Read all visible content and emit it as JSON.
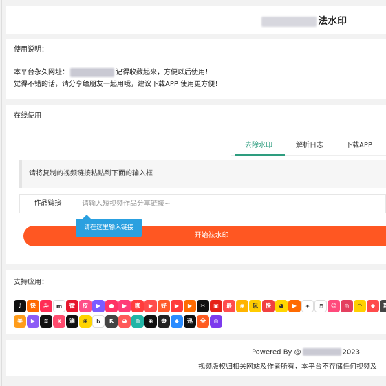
{
  "header": {
    "title_suffix": "法水印"
  },
  "instructions": {
    "heading": "使用说明：",
    "line1_prefix": "本平台永久网址：",
    "line1_suffix": "记得收藏起来，方便以后使用！",
    "line2": "觉得不错的话，请分享给朋友一起用哦，建议下载APP 使用更方便！"
  },
  "online": {
    "heading": "在线使用",
    "tabs": [
      {
        "label": "去除水印",
        "active": true
      },
      {
        "label": "解析日志",
        "active": false
      },
      {
        "label": "下载APP",
        "active": false
      }
    ],
    "notice": "请将复制的视频链接粘贴到下面的输入框",
    "input_label": "作品链接",
    "input_placeholder": "请输入短视频作品分享链接~",
    "input_value": "",
    "tooltip": "请在这里输入链接",
    "start_button": "开始祛水印"
  },
  "apps": {
    "heading": "支持应用：",
    "row1": [
      {
        "name": "douyin-icon",
        "color": "#111111",
        "glyph": "♪"
      },
      {
        "name": "kuaishou-icon",
        "color": "#ff6a00",
        "glyph": "快"
      },
      {
        "name": "doushou-icon",
        "color": "#ff2d55",
        "glyph": "斗"
      },
      {
        "name": "lvzhou-icon",
        "color": "#ffffff",
        "glyph": "m"
      },
      {
        "name": "weibo-icon",
        "color": "#e6162d",
        "glyph": "微"
      },
      {
        "name": "pipixia-icon",
        "color": "#ff4d88",
        "glyph": "皮"
      },
      {
        "name": "bbq-icon",
        "color": "#7a5cff",
        "glyph": "▶"
      },
      {
        "name": "weishi-icon",
        "color": "#ff3366",
        "glyph": "●"
      },
      {
        "name": "kuaishou-lite-icon",
        "color": "#ff3c78",
        "glyph": "▶"
      },
      {
        "name": "xiaokaxiu-icon",
        "color": "#ff3d3d",
        "glyph": "咖"
      },
      {
        "name": "quanmin-icon",
        "color": "#ff4b4b",
        "glyph": "▶"
      },
      {
        "name": "haokan-icon",
        "color": "#ff5a2b",
        "glyph": "好"
      },
      {
        "name": "xigua-icon",
        "color": "#ff3b3b",
        "glyph": "▶"
      },
      {
        "name": "play-icon",
        "color": "#ff6b00",
        "glyph": "▶"
      },
      {
        "name": "jianying-icon",
        "color": "#111111",
        "glyph": "✂"
      },
      {
        "name": "video-icon",
        "color": "#e62117",
        "glyph": "▣"
      },
      {
        "name": "zuiyou-icon",
        "color": "#ff4d4d",
        "glyph": "最"
      },
      {
        "name": "weishi2-icon",
        "color": "#ffb400",
        "glyph": "◉"
      },
      {
        "name": "wan-icon",
        "color": "#ffcc00",
        "glyph": "玩"
      },
      {
        "name": "kuaibao-icon",
        "color": "#f04040",
        "glyph": "快"
      },
      {
        "name": "duoduo-icon",
        "color": "#ffd600",
        "glyph": "◕"
      },
      {
        "name": "momo-icon",
        "color": "#ff6a00",
        "glyph": "▶"
      },
      {
        "name": "twitter-icon",
        "color": "#ffffff",
        "glyph": "✦"
      },
      {
        "name": "tiktok2-icon",
        "color": "#ffffff",
        "glyph": "♬"
      },
      {
        "name": "acfun-icon",
        "color": "#ff4a7c",
        "glyph": "☺"
      },
      {
        "name": "instagram-icon",
        "color": "#e4405f",
        "glyph": "◎"
      },
      {
        "name": "biyu-icon",
        "color": "#ffd000",
        "glyph": "◠"
      },
      {
        "name": "qianyu-icon",
        "color": "#ff4b4b",
        "glyph": "◆"
      },
      {
        "name": "wu-icon",
        "color": "#444444",
        "glyph": "舞"
      },
      {
        "name": "kuaimao-icon",
        "color": "#ff4040",
        "glyph": "◑"
      }
    ],
    "row2": [
      {
        "name": "meipai-icon",
        "color": "#ff9c1a",
        "glyph": "美"
      },
      {
        "name": "sohu-icon",
        "color": "#8b5cf6",
        "glyph": "▶"
      },
      {
        "name": "tantan-icon",
        "color": "#111111",
        "glyph": "≋"
      },
      {
        "name": "keyu-icon",
        "color": "#ff4b6e",
        "glyph": "k"
      },
      {
        "name": "chidian-icon",
        "color": "#111111",
        "glyph": "滴"
      },
      {
        "name": "weiliao-icon",
        "color": "#ffd400",
        "glyph": "◉"
      },
      {
        "name": "bo-icon",
        "color": "#ffffff",
        "glyph": "b"
      },
      {
        "name": "kuaiyin-icon",
        "color": "#444444",
        "glyph": "K"
      },
      {
        "name": "xiaoyu-icon",
        "color": "#ff5a5a",
        "glyph": "◕"
      },
      {
        "name": "quan-icon",
        "color": "#22b5a6",
        "glyph": "◍"
      },
      {
        "name": "mo-icon",
        "color": "#111111",
        "glyph": "◉"
      },
      {
        "name": "houzi-icon",
        "color": "#222222",
        "glyph": "☻"
      },
      {
        "name": "yuyin-icon",
        "color": "#2b8cff",
        "glyph": "◆"
      },
      {
        "name": "biaoqing-icon",
        "color": "#111111",
        "glyph": "迅"
      },
      {
        "name": "huoshan-icon",
        "color": "#ff5a1f",
        "glyph": "全"
      },
      {
        "name": "dianyu-icon",
        "color": "#7c3aed",
        "glyph": "◎"
      }
    ]
  },
  "footer": {
    "powered_prefix": "Powered By ",
    "powered_at": "@",
    "powered_year": "2023",
    "copyright": "视频版权归相关网站及作者所有，本平台不存储任何视频及"
  }
}
